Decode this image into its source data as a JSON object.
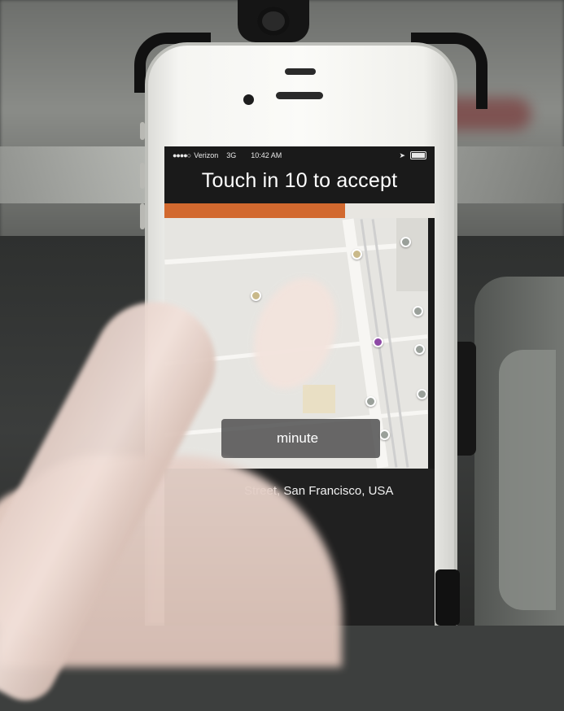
{
  "statusbar": {
    "signal": "●●●●○",
    "carrier": "Verizon",
    "network": "3G",
    "time": "10:42 AM",
    "location_icon": "location-arrow-icon",
    "battery_icon": "battery-icon"
  },
  "prompt": {
    "title": "Touch in 10 to accept",
    "progress_fraction": 0.67,
    "progress_color": "#d2692f"
  },
  "eta": {
    "label": "minute"
  },
  "address": {
    "text": "Street, San Francisco, USA"
  }
}
